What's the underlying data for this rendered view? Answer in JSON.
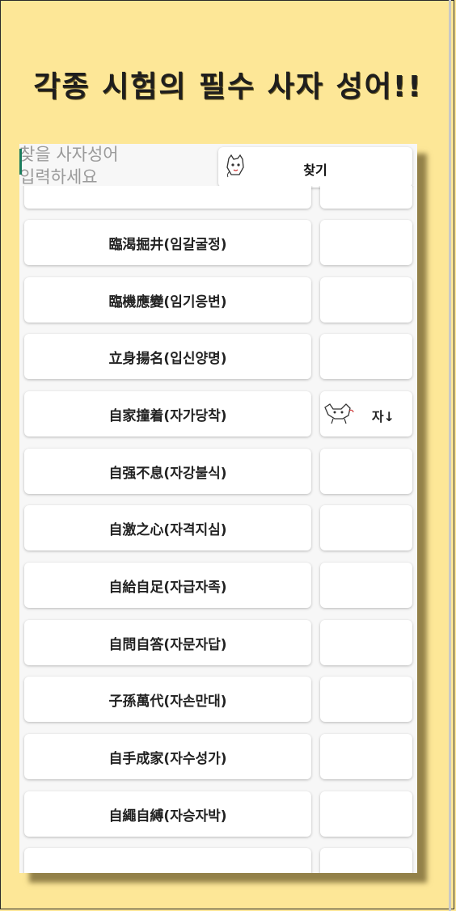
{
  "headline": "각종 시험의 필수 사자 성어!!",
  "search": {
    "placeholder_line1": "찾을 사자성어",
    "placeholder_line2": "입력하세요",
    "button_label": "찾기"
  },
  "list": {
    "items": [
      {
        "word": ""
      },
      {
        "word": "臨渴掘井(임갈굴정)"
      },
      {
        "word": "臨機應變(임기응변)"
      },
      {
        "word": "立身揚名(입신양명)"
      },
      {
        "word": "自家撞着(자가당착)"
      },
      {
        "word": "自强不息(자강불식)"
      },
      {
        "word": "自激之心(자격지심)"
      },
      {
        "word": "自給自足(자급자족)"
      },
      {
        "word": "自問自答(자문자답)"
      },
      {
        "word": "子孫萬代(자손만대)"
      },
      {
        "word": "自手成家(자수성가)"
      },
      {
        "word": "自繩自縛(자승자박)"
      },
      {
        "word": ""
      }
    ],
    "index_button_label": "자↓"
  }
}
